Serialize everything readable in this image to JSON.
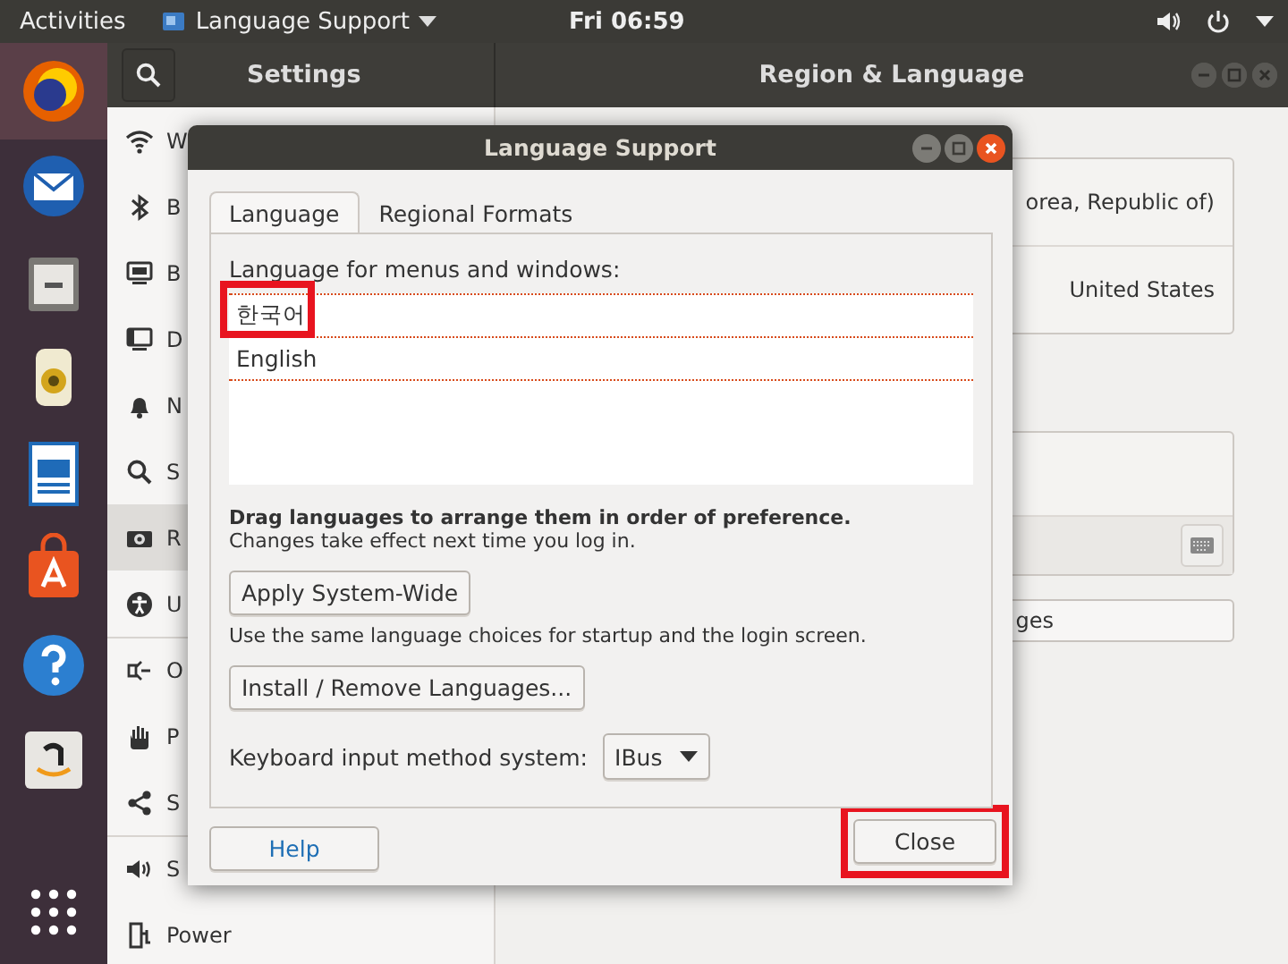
{
  "top_bar": {
    "activities": "Activities",
    "app_menu": "Language Support",
    "clock": "Fri 06:59"
  },
  "settings_window": {
    "header_title": "Settings",
    "title": "Region & Language",
    "sidebar": {
      "items": [
        {
          "label": "W",
          "kind": "wifi",
          "selected": false
        },
        {
          "label": "B",
          "kind": "bluetooth",
          "selected": false
        },
        {
          "label": "B",
          "kind": "monitor",
          "selected": false
        },
        {
          "label": "D",
          "kind": "dock",
          "selected": false
        },
        {
          "label": "N",
          "kind": "bell",
          "selected": false
        },
        {
          "label": "S",
          "kind": "search",
          "selected": false
        },
        {
          "label": "R",
          "kind": "region",
          "selected": true
        },
        {
          "label": "U",
          "kind": "accessibility",
          "selected": false
        },
        {
          "label": "O",
          "kind": "online",
          "selected": false,
          "divider_above": true
        },
        {
          "label": "P",
          "kind": "hand",
          "selected": false
        },
        {
          "label": "S",
          "kind": "share",
          "selected": false
        },
        {
          "label": "S",
          "kind": "sound",
          "selected": false,
          "divider_above": true
        },
        {
          "label": "Power",
          "kind": "power",
          "selected": false
        }
      ]
    },
    "content": {
      "language_value": "orea, Republic of)",
      "formats_value": "United States",
      "manage_button": "ges"
    }
  },
  "dialog": {
    "title": "Language Support",
    "tabs": [
      {
        "label": "Language",
        "selected": true
      },
      {
        "label": "Regional Formats",
        "selected": false
      }
    ],
    "list_label": "Language for menus and windows:",
    "languages": [
      {
        "name": "한국어",
        "highlighted": true
      },
      {
        "name": "English",
        "highlighted": false
      }
    ],
    "drag_hint": "Drag languages to arrange them in order of preference.",
    "drag_note": "Changes take effect next time you log in.",
    "apply_button": "Apply System-Wide",
    "apply_note": "Use the same language choices for startup and the login screen.",
    "install_button": "Install / Remove Languages...",
    "input_method_label": "Keyboard input method system:",
    "input_method": "IBus",
    "help_button": "Help",
    "close_button": {
      "label": "Close",
      "highlighted": true
    }
  }
}
